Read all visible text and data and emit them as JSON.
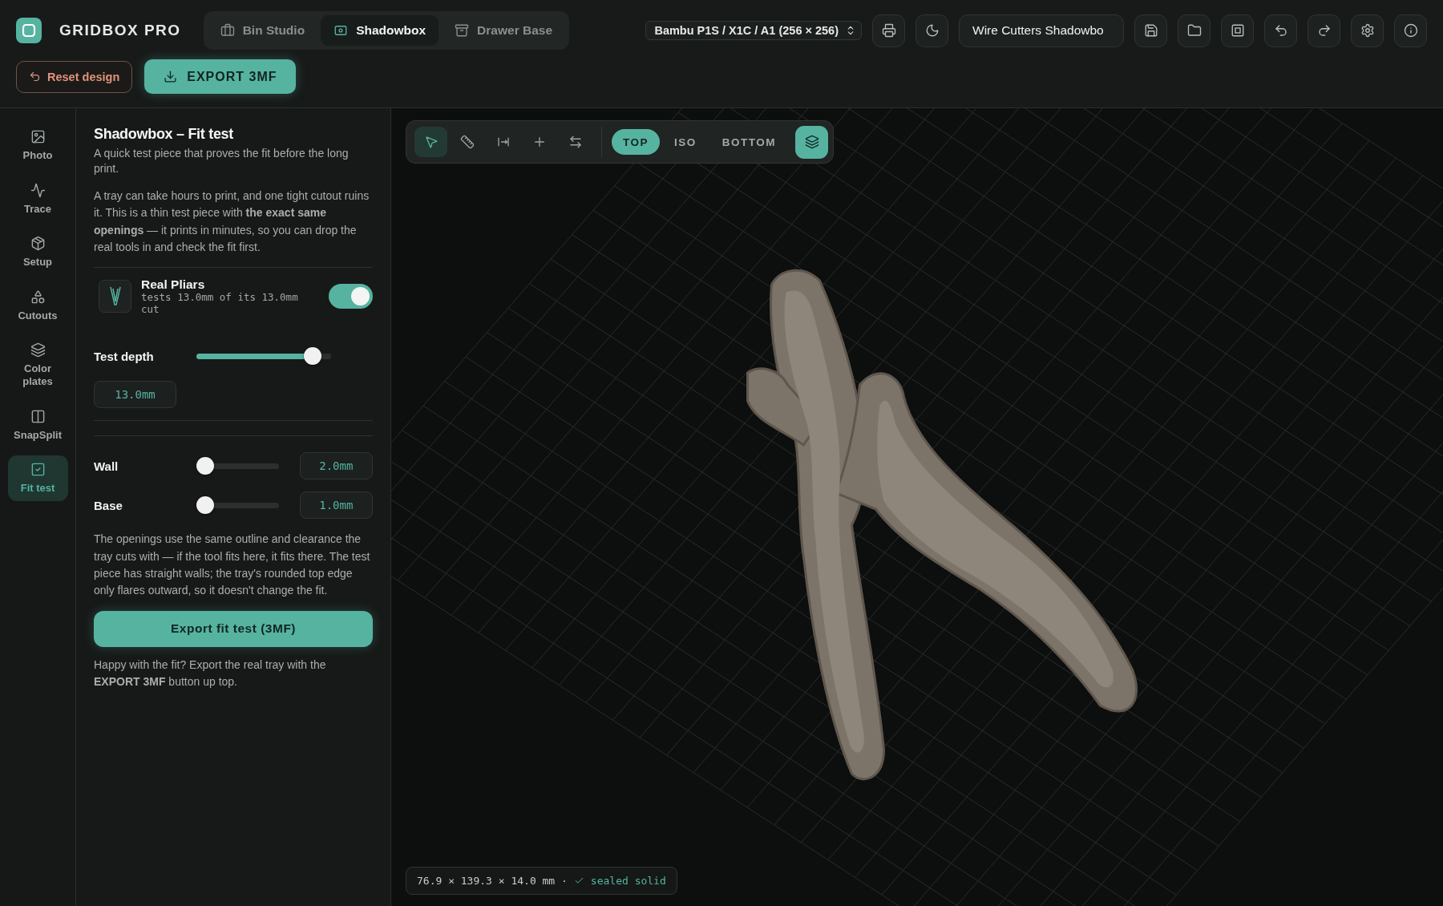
{
  "brand": "GRIDBOX PRO",
  "mode_tabs": [
    {
      "label": "Bin Studio",
      "selected": false
    },
    {
      "label": "Shadowbox",
      "selected": true
    },
    {
      "label": "Drawer Base",
      "selected": false
    }
  ],
  "printer_select": {
    "value": "Bambu P1S / X1C / A1 (256 × 256)"
  },
  "project_name": {
    "value": "Wire Cutters Shadowbo"
  },
  "reset_button": "Reset design",
  "export_button": "EXPORT 3MF",
  "rail": [
    {
      "label": "Photo",
      "selected": false
    },
    {
      "label": "Trace",
      "selected": false
    },
    {
      "label": "Setup",
      "selected": false
    },
    {
      "label": "Cutouts",
      "selected": false
    },
    {
      "label": "Color plates",
      "selected": false
    },
    {
      "label": "SnapSplit",
      "selected": false
    },
    {
      "label": "Fit test",
      "selected": true
    }
  ],
  "panel": {
    "title": "Shadowbox – Fit test",
    "subtitle": "A quick test piece that proves the fit before the long print.",
    "intro": "A tray can take hours to print, and one tight cutout ruins it. This is a thin test piece with **the exact same openings** — it prints in minutes, so you can drop the real tools in and check the fit first.",
    "tool": {
      "name": "Real Pliars",
      "detail": "tests 13.0mm of its 13.0mm cut",
      "on": true
    },
    "test_depth": {
      "label": "Test depth",
      "level": 0.92,
      "value": "13.0mm"
    },
    "params": [
      {
        "label": "Wall",
        "level": 0,
        "value": "2.0mm"
      },
      {
        "label": "Base",
        "level": 0,
        "value": "1.0mm"
      }
    ],
    "note": "The openings use the same outline and clearance the tray cuts with — if the tool fits here, it fits there. The test piece has straight walls; the tray's rounded top edge only flares outward, so it doesn't change the fit.",
    "export_fit_button": "Export fit test (3MF)",
    "footer": "Happy with the fit? Export the real tray with the **EXPORT 3MF** button up top."
  },
  "viewport": {
    "tools": [
      {
        "selected": true
      },
      {
        "selected": false
      },
      {
        "selected": false
      },
      {
        "selected": false
      },
      {
        "selected": false
      }
    ],
    "views": [
      {
        "label": "TOP",
        "selected": true
      },
      {
        "label": "ISO",
        "selected": false
      },
      {
        "label": "BOTTOM",
        "selected": false
      }
    ],
    "layers_on": true,
    "dimensions": "76.9 × 139.3 × 14.0 mm ·",
    "status": "sealed solid"
  }
}
